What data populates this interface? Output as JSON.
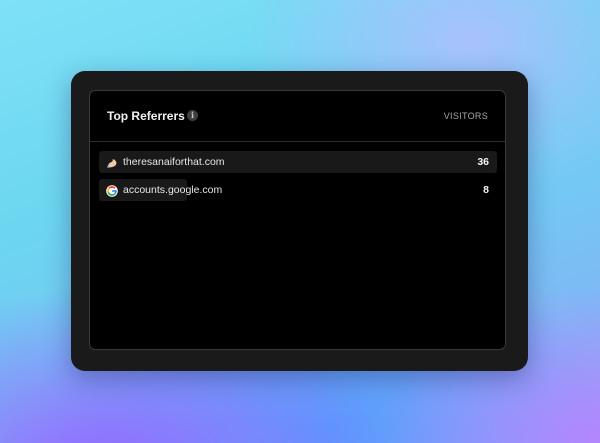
{
  "card": {
    "title": "Top Referrers",
    "info_icon": "info-icon",
    "info_glyph": "i",
    "column_header": "VISITORS"
  },
  "max_visitors": 36,
  "referrers": [
    {
      "label": "theresanaiforthat.com",
      "visitors": "36",
      "icon": "flexed-arm-icon"
    },
    {
      "label": "accounts.google.com",
      "visitors": "8",
      "icon": "google-icon"
    }
  ]
}
